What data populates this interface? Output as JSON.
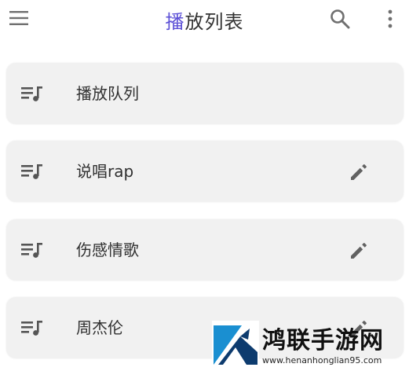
{
  "header": {
    "title_first_char": "播",
    "title_rest": "放列表",
    "accent_color": "#5b4fd6",
    "left_icon": "menu-icon",
    "right_icons": [
      "search-icon",
      "more-vert-icon"
    ]
  },
  "playlists": [
    {
      "name": "播放队列",
      "icon": "queue-music-icon",
      "editable": false
    },
    {
      "name": "说唱rap",
      "icon": "queue-music-icon",
      "editable": true
    },
    {
      "name": "伤感情歌",
      "icon": "queue-music-icon",
      "editable": true
    },
    {
      "name": "周杰伦",
      "icon": "queue-music-icon",
      "editable": true
    }
  ],
  "watermark": {
    "brand": "鸿联手游网",
    "url": "www.henanhonglian95.com"
  }
}
